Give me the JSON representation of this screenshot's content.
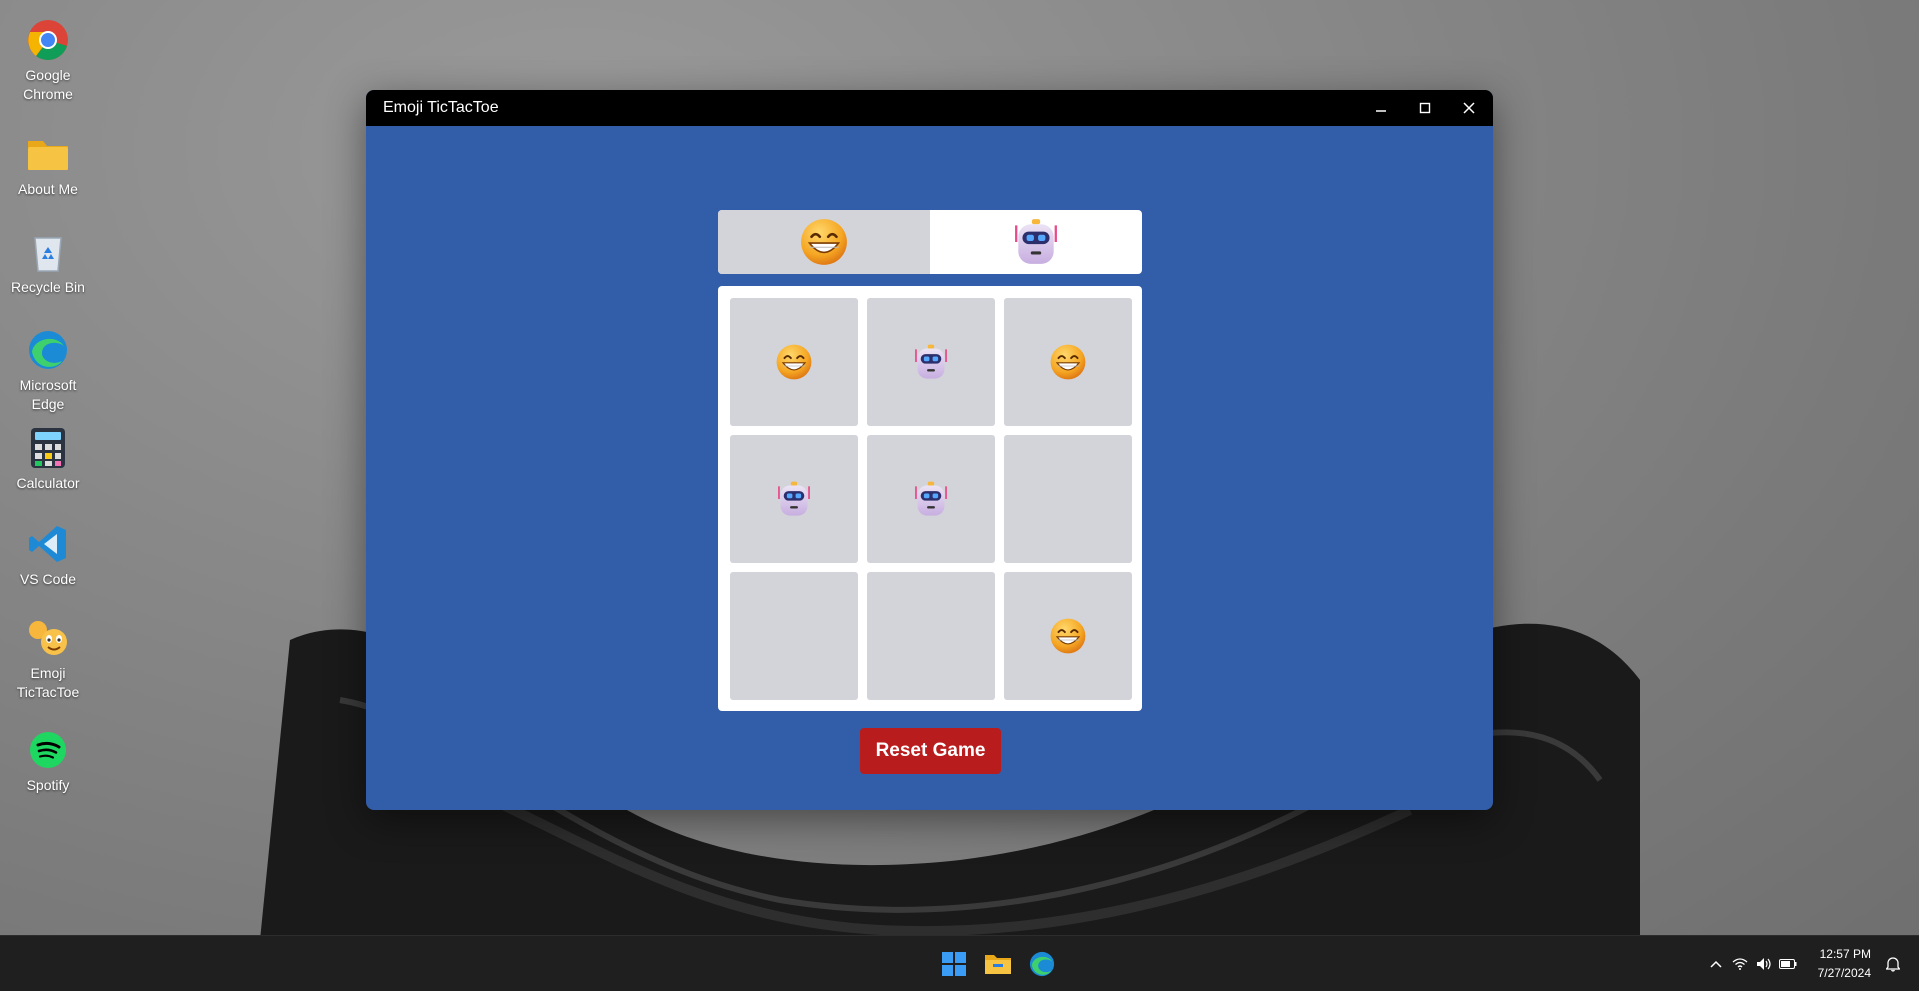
{
  "desktop": {
    "icons": [
      {
        "label": "Google Chrome",
        "icon": "chrome-icon"
      },
      {
        "label": "About Me",
        "icon": "folder-icon"
      },
      {
        "label": "Recycle Bin",
        "icon": "recycle-bin-icon"
      },
      {
        "label": "Microsoft Edge",
        "icon": "edge-icon"
      },
      {
        "label": "Calculator",
        "icon": "calculator-icon"
      },
      {
        "label": "VS Code",
        "icon": "vscode-icon"
      },
      {
        "label": "Emoji TicTacToe",
        "icon": "emoji-tictactoe-icon"
      },
      {
        "label": "Spotify",
        "icon": "spotify-icon"
      }
    ]
  },
  "window": {
    "title": "Emoji TicTacToe",
    "controls": [
      "minimize-icon",
      "maximize-icon",
      "close-icon"
    ]
  },
  "game": {
    "players": [
      {
        "emoji": "grinning-face",
        "active": true
      },
      {
        "emoji": "robot-face",
        "active": false
      }
    ],
    "board": [
      "grin",
      "robot",
      "grin",
      "robot",
      "robot",
      "",
      "",
      "",
      "grin"
    ],
    "reset_label": "Reset Game"
  },
  "taskbar": {
    "apps": [
      "windows-start-icon",
      "file-explorer-icon",
      "edge-icon"
    ],
    "tray_icons": [
      "chevron-up-icon",
      "wifi-icon",
      "volume-icon",
      "battery-icon",
      "notification-bell-icon"
    ],
    "time": "12:57 PM",
    "date": "7/27/2024"
  },
  "colors": {
    "window_bg": "#325ea9",
    "cell_bg": "#d3d4d9",
    "reset_button": "#b91c1c",
    "taskbar": "#1f1f1f"
  }
}
